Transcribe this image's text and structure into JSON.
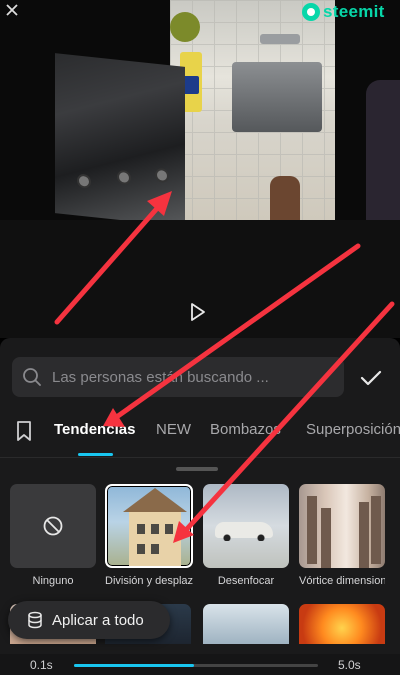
{
  "watermark": {
    "text": "steemit",
    "color": "#07d7a9"
  },
  "preview": {
    "collapse_icon": "collapse-arrows-icon",
    "play_icon": "play-icon"
  },
  "search": {
    "placeholder": "Las personas están buscando ...",
    "icon": "search-icon",
    "confirm_icon": "checkmark-icon"
  },
  "tabs": {
    "bookmark_icon": "bookmark-icon",
    "items": [
      {
        "label": "Tendencias",
        "active": true
      },
      {
        "label": "NEW",
        "active": false
      },
      {
        "label": "Bombazos",
        "active": false
      },
      {
        "label": "Superposición",
        "active": false
      }
    ]
  },
  "effects": [
    {
      "label": "Ninguno",
      "selected": false,
      "icon": "no-entry-icon"
    },
    {
      "label": "División y desplazamiento",
      "selected": true
    },
    {
      "label": "Desenfocar",
      "selected": false
    },
    {
      "label": "Vórtice dimensional",
      "selected": false
    }
  ],
  "apply_all": {
    "label": "Aplicar a todo",
    "icon": "stack-icon"
  },
  "duration": {
    "min_label": "0.1s",
    "max_label": "5.0s",
    "value_fraction": 0.49
  },
  "colors": {
    "accent": "#19c6f0",
    "annotation_arrow": "#f5333f"
  }
}
